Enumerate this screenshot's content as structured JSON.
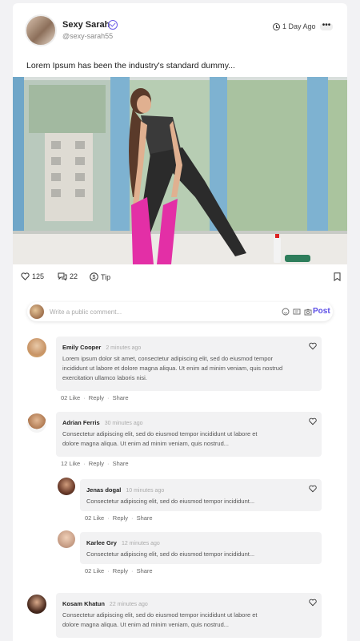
{
  "post": {
    "author_name": "Sexy Sarah",
    "author_handle": "@sexy-sarah55",
    "time_ago": "1 Day Ago",
    "more_label": "•••",
    "caption": "Lorem Ipsum has been the industry's standard dummy...",
    "likes": "125",
    "comments": "22",
    "tip_label": "Tip"
  },
  "comment_box": {
    "placeholder": "Write a public comment...",
    "post_label": "Post"
  },
  "comments": [
    {
      "name": "Emily Cooper",
      "time": "2 minutes ago",
      "text_lines": [
        "Lorem ipsum dolor sit amet, consectetur adipiscing elit, sed do eiusmod tempor",
        "incididunt ut labore et dolore magna aliqua. Ut enim ad minim veniam, quis nostrud",
        "exercitation ullamco laboris nisi."
      ],
      "likes": "02 Like",
      "reply": "Reply",
      "share": "Share"
    },
    {
      "name": "Adrian Ferris",
      "time": "30 minutes ago",
      "text_lines": [
        "Consectetur adipiscing elit, sed do eiusmod tempor incididunt ut labore et",
        "dolore magna aliqua. Ut enim ad minim veniam, quis nostrud..."
      ],
      "likes": "12 Like",
      "reply": "Reply",
      "share": "Share"
    },
    {
      "name": "Jenas dogal",
      "time": "10 minutes ago",
      "text_lines": [
        "Consectetur adipiscing elit, sed do eiusmod tempor incididunt..."
      ],
      "likes": "02 Like",
      "reply": "Reply",
      "share": "Share"
    },
    {
      "name": "Karlee Gry",
      "time": "12 minutes ago",
      "text_lines": [
        "Consectetur adipiscing elit, sed do eiusmod tempor incididunt..."
      ],
      "likes": "02 Like",
      "reply": "Reply",
      "share": "Share"
    },
    {
      "name": "Kosam Khatun",
      "time": "22 minutes ago",
      "text_lines": [
        "Consectetur adipiscing elit, sed do eiusmod tempor incididunt ut labore et",
        "dolore magna aliqua. Ut enim ad minim veniam, quis nostrud..."
      ]
    }
  ],
  "icons": {
    "verified": "verified-badge-icon",
    "clock": "clock-icon",
    "heart": "heart-icon",
    "comment": "comment-icon",
    "tip": "dollar-icon",
    "bookmark": "bookmark-icon",
    "emoji": "emoji-icon",
    "gif": "gif-icon",
    "camera": "camera-icon"
  },
  "colors": {
    "accent": "#5b4de6",
    "bubble": "#f2f2f3"
  }
}
